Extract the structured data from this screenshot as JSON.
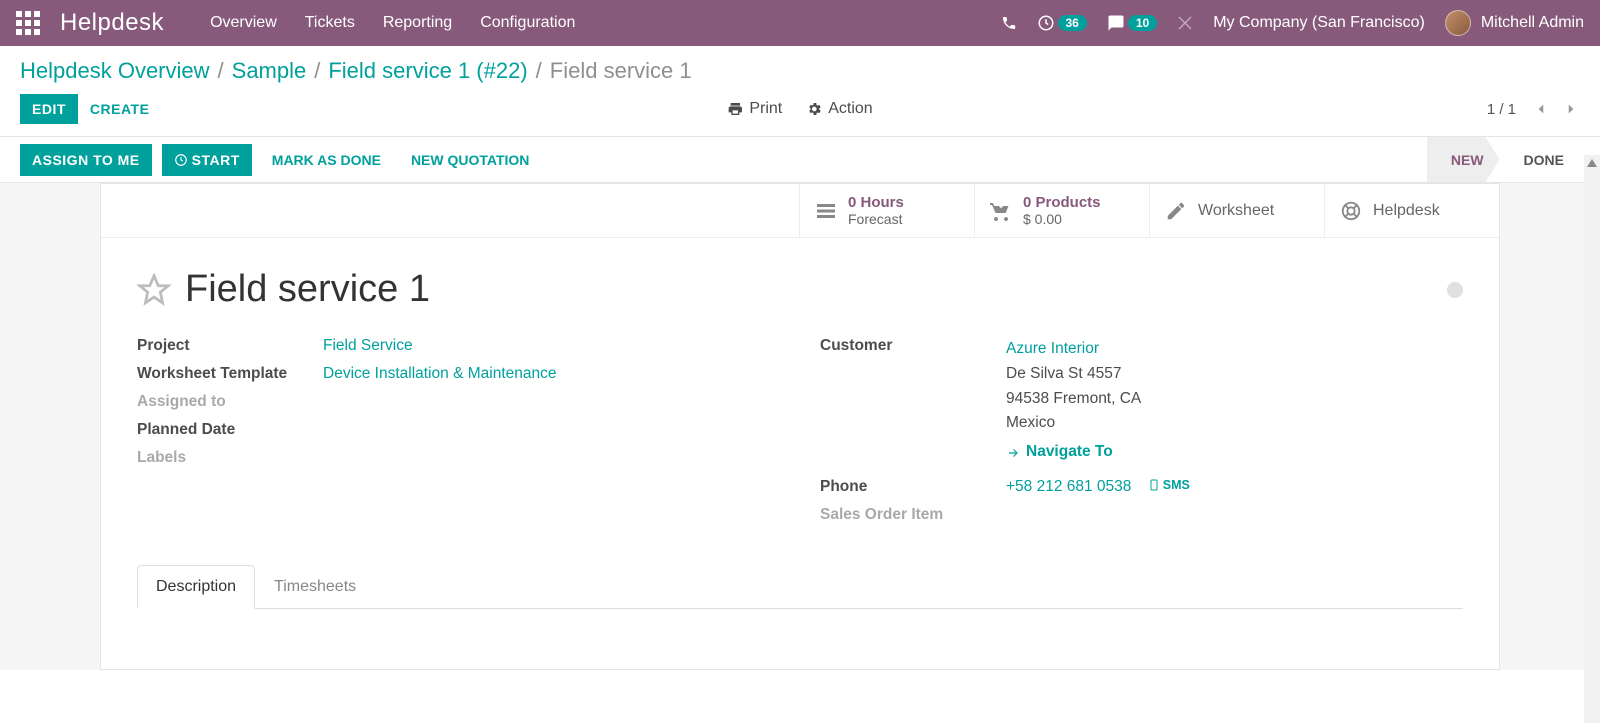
{
  "header": {
    "app_title": "Helpdesk",
    "nav": {
      "overview": "Overview",
      "tickets": "Tickets",
      "reporting": "Reporting",
      "configuration": "Configuration"
    },
    "activity_count": "36",
    "discuss_count": "10",
    "company": "My Company (San Francisco)",
    "user_name": "Mitchell Admin"
  },
  "breadcrumb": {
    "a0": "Helpdesk Overview",
    "a1": "Sample",
    "a2": "Field service 1 (#22)",
    "current": "Field service 1"
  },
  "control": {
    "edit": "EDIT",
    "create": "CREATE",
    "print": "Print",
    "action": "Action",
    "pager": "1 / 1"
  },
  "actions": {
    "assign_to_me": "ASSIGN TO ME",
    "start": "START",
    "mark_done": "MARK AS DONE",
    "new_quotation": "NEW QUOTATION"
  },
  "status": {
    "new": "NEW",
    "done": "DONE"
  },
  "stats": {
    "hours": {
      "line1": "0  Hours",
      "line2": "Forecast"
    },
    "products": {
      "line1": "0 Products",
      "line2": "$ 0.00"
    },
    "worksheet": "Worksheet",
    "helpdesk": "Helpdesk"
  },
  "record": {
    "title": "Field service 1",
    "left": {
      "project_label": "Project",
      "project_value": "Field Service",
      "wtpl_label": "Worksheet Template",
      "wtpl_value": "Device Installation & Maintenance",
      "assigned_label": "Assigned to",
      "planned_label": "Planned Date",
      "labels_label": "Labels"
    },
    "right": {
      "customer_label": "Customer",
      "customer_name": "Azure Interior",
      "addr1": "De Silva St 4557",
      "addr2": "94538 Fremont, CA",
      "addr3": "Mexico",
      "navigate": "Navigate To",
      "phone_label": "Phone",
      "phone_value": "+58 212 681 0538",
      "sms": "SMS",
      "soi_label": "Sales Order Item"
    }
  },
  "tabs": {
    "description": "Description",
    "timesheets": "Timesheets"
  }
}
